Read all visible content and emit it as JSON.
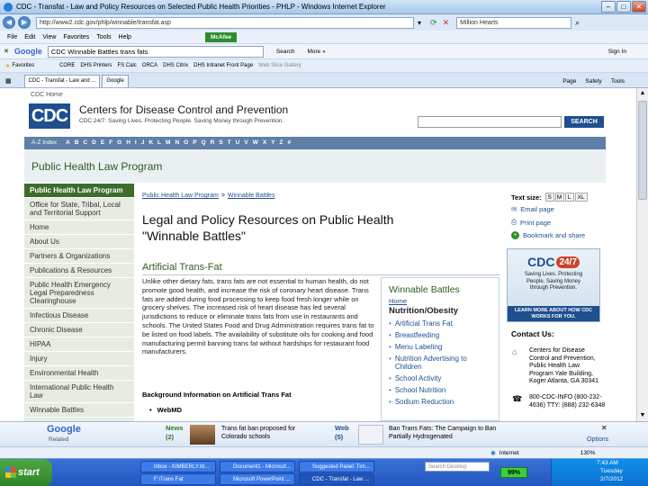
{
  "window": {
    "title": "CDC - Transfat - Law and Policy Resources on Selected Public Health Priorities - PHLP - Windows Internet Explorer",
    "address": "http://www2.cdc.gov/phlp/winnable/transfat.asp",
    "search_box": "Million Hearts"
  },
  "menu": [
    "File",
    "Edit",
    "View",
    "Favorites",
    "Tools",
    "Help"
  ],
  "google_bar": {
    "query": "CDC Winnable Battles trans fats",
    "search_label": "Search",
    "more_label": "More »",
    "mcafee": "McAfee",
    "signin": "Sign In"
  },
  "favorites": {
    "label": "Favorites",
    "links": [
      "CORE",
      "DHS Printers",
      "FS Calc",
      "ORCA",
      "DHS Citrix",
      "DHS Intranet Front Page",
      "Web Slice Gallery"
    ]
  },
  "tabs": [
    {
      "label": "CDC - Transfat - Law and ...",
      "active": true
    },
    {
      "label": "Google",
      "active": false
    }
  ],
  "command_bar": {
    "page": "Page",
    "safety": "Safety",
    "tools": "Tools"
  },
  "site": {
    "home_link": "CDC Home",
    "logo": "CDC",
    "org_name": "Centers for Disease Control and Prevention",
    "tagline": "CDC 24/7: Saving Lives. Protecting People. Saving Money through Prevention.",
    "search_button": "SEARCH",
    "az_label": "A-Z Index",
    "az_letters": [
      "A",
      "B",
      "C",
      "D",
      "E",
      "F",
      "G",
      "H",
      "I",
      "J",
      "K",
      "L",
      "M",
      "N",
      "O",
      "P",
      "Q",
      "R",
      "S",
      "T",
      "U",
      "V",
      "W",
      "X",
      "Y",
      "Z",
      "#"
    ],
    "program_title": "Public Health Law Program"
  },
  "left_nav": [
    "Public Health Law Program",
    "Office for State, Tribal, Local and Territorial Support",
    "Home",
    "About Us",
    "Partners & Organizations",
    "Publications & Resources",
    "Public Health Emergency Legal Preparedness Clearinghouse",
    "Infectious Disease",
    "Chronic Disease",
    "HIPAA",
    "Injury",
    "Environmental Health",
    "International Public Health Law",
    "Winnable Battles"
  ],
  "main": {
    "breadcrumb_1": "Public Health Law Program",
    "breadcrumb_sep": ">",
    "breadcrumb_2": "Winnable Battles",
    "heading": "Legal and Policy Resources on Public Health \"Winnable Battles\"",
    "section_title": "Artificial Trans-Fat",
    "body": "Unlike other dietary fats, trans fats are not essential to human health, do not promote good health, and increase the risk of coronary heart disease. Trans fats are added during food processing to keep food fresh longer while on grocery shelves. The increased risk of heart disease has led several jurisdictions to reduce or eliminate trans fats from use in restaurants and schools.  The United States Food and Drug Administration requires trans fat to be listed on food labels.  The availability of substitute oils for cooking and food manufacturing permit banning trans fat without hardships for restaurant food manufacturers.",
    "background_heading": "Background Information on Artificial Trans Fat",
    "bullet_1": "WebMD"
  },
  "winnable_box": {
    "title": "Winnable Battles",
    "home": "Home",
    "subtitle": "Nutrition/Obesity",
    "items": [
      "Artificial Trans Fat",
      "Breastfeeding",
      "Menu Labeling",
      "Nutrition Advertising to Children",
      "School Activity",
      "School Nutrition",
      "Sodium Reduction"
    ]
  },
  "right_col": {
    "text_size_label": "Text size:",
    "sizes": [
      "S",
      "M",
      "L",
      "XL"
    ],
    "email": "Email page",
    "print": "Print page",
    "bookmark": "Bookmark and share",
    "cdc247_a": "CDC",
    "cdc247_b": "24/7",
    "cdc247_tag": "Saving Lives. Protecting People. Saving Money through Prevention.",
    "cdc247_more": "LEARN MORE ABOUT HOW CDC WORKS FOR YOU.",
    "contact_title": "Contact Us:",
    "contact_addr": "Centers for Disease Control and Prevention, Public Health Law Program Yale Building, Koger Atlanta, GA 30341",
    "phone": "800-CDC-INFO (800-232-4636) TTY: (888) 232-6348"
  },
  "related_bar": {
    "google": "Google",
    "related": "Related",
    "news_label": "News",
    "news_count": "(2)",
    "news_text": "Trans fat ban proposed for Colorado schools",
    "web_label": "Web",
    "web_count": "(5)",
    "web_text": "Ban Trans Fats: The Campaign to Ban Partially Hydrogenated",
    "options": "Options"
  },
  "status": {
    "zone": "Internet",
    "zoom": "130%"
  },
  "taskbar": {
    "start": "start",
    "row1": [
      "Inbox - KIMBERLY.W...",
      "Document1 - Microsof...",
      "Suggested Panel: Tim..."
    ],
    "row2": [
      "F:\\Trans Fat",
      "Microsoft PowerPoint ...",
      "CDC - Transfat - Law ..."
    ],
    "search_placeholder": "Search Desktop",
    "battery": "99%",
    "time": "7:43 AM",
    "day": "Tuesday",
    "date": "2/7/2012"
  }
}
